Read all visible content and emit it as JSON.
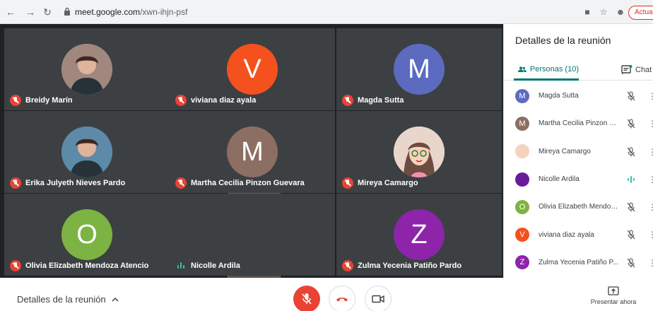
{
  "browser": {
    "url_host": "meet.google.com",
    "url_path": "/xwn-ihjn-psf",
    "update_label": "Actual"
  },
  "tiles": [
    {
      "name": "Breidy Marín",
      "avatar_type": "photo",
      "avatar_color": "#a1887f",
      "mic": "off"
    },
    {
      "name": "viviana diaz ayala",
      "avatar_type": "letter",
      "letter": "V",
      "avatar_color": "#f4511e",
      "mic": "off"
    },
    {
      "name": "Magda Sutta",
      "avatar_type": "letter",
      "letter": "M",
      "avatar_color": "#5c6bc0",
      "mic": "off"
    },
    {
      "name": "Erika Julyeth Nieves Pardo",
      "avatar_type": "photo",
      "avatar_color": "#5d8aa8",
      "mic": "off"
    },
    {
      "name": "Martha Cecilia Pinzon Guevara",
      "avatar_type": "letter",
      "letter": "M",
      "avatar_color": "#8d6e63",
      "mic": "off"
    },
    {
      "name": "Mireya Camargo",
      "avatar_type": "cartoon",
      "avatar_color": "#f3d3c0",
      "mic": "off"
    },
    {
      "name": "Olivia Elizabeth Mendoza Atencio",
      "avatar_type": "letter",
      "letter": "O",
      "avatar_color": "#7cb342",
      "mic": "off"
    },
    {
      "name": "Nicolle Ardila",
      "avatar_type": "video",
      "avatar_color": "#8a7868",
      "mic": "speaking"
    },
    {
      "name": "Zulma Yecenia Patiño Pardo",
      "avatar_type": "letter",
      "letter": "Z",
      "avatar_color": "#8e24aa",
      "mic": "off"
    }
  ],
  "panel": {
    "title": "Detalles de la reunión",
    "tab_people": "Personas (10)",
    "tab_chat": "Chat",
    "accent": "#00796b",
    "participants": [
      {
        "name": "Magda Sutta",
        "letter": "M",
        "color": "#5c6bc0",
        "mic": "off"
      },
      {
        "name": "Martha Cecilia Pinzon G...",
        "letter": "M",
        "color": "#8d6e63",
        "mic": "off"
      },
      {
        "name": "Mireya Camargo",
        "letter": "",
        "color": "#f3d3c0",
        "mic": "off"
      },
      {
        "name": "Nicolle Ardila",
        "letter": "",
        "color": "#6a1b9a",
        "mic": "speaking"
      },
      {
        "name": "Olivia Elizabeth Mendoz...",
        "letter": "O",
        "color": "#7cb342",
        "mic": "off"
      },
      {
        "name": "viviana diaz ayala",
        "letter": "V",
        "color": "#f4511e",
        "mic": "off"
      },
      {
        "name": "Zulma Yecenia Patiño P...",
        "letter": "Z",
        "color": "#8e24aa",
        "mic": "off"
      }
    ]
  },
  "bottom": {
    "details_label": "Detalles de la reunión",
    "present_label": "Presentar ahora"
  }
}
